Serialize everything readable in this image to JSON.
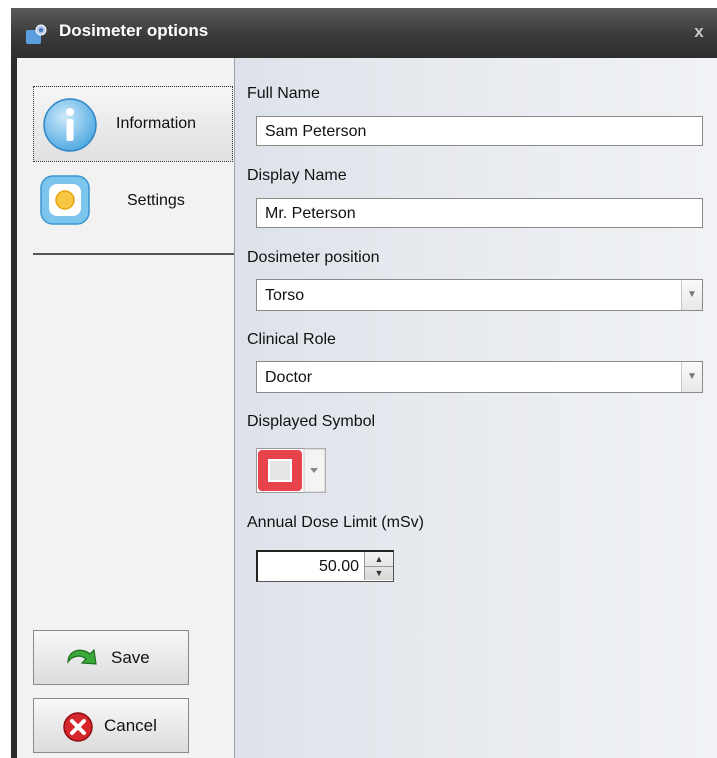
{
  "window": {
    "title": "Dosimeter options",
    "close_glyph": "x"
  },
  "sidebar": {
    "items": [
      {
        "label": "Information",
        "icon": "info-icon",
        "selected": true
      },
      {
        "label": "Settings",
        "icon": "settings-icon",
        "selected": false
      }
    ],
    "save_label": "Save",
    "cancel_label": "Cancel"
  },
  "form": {
    "full_name": {
      "label": "Full Name",
      "value": "Sam Peterson"
    },
    "display_name": {
      "label": "Display Name",
      "value": "Mr. Peterson"
    },
    "dosimeter_position": {
      "label": "Dosimeter position",
      "value": "Torso"
    },
    "clinical_role": {
      "label": "Clinical Role",
      "value": "Doctor"
    },
    "displayed_symbol": {
      "label": "Displayed Symbol",
      "color": "#e8424a"
    },
    "annual_dose_limit": {
      "label": "Annual Dose Limit (mSv)",
      "value": "50.00"
    }
  }
}
